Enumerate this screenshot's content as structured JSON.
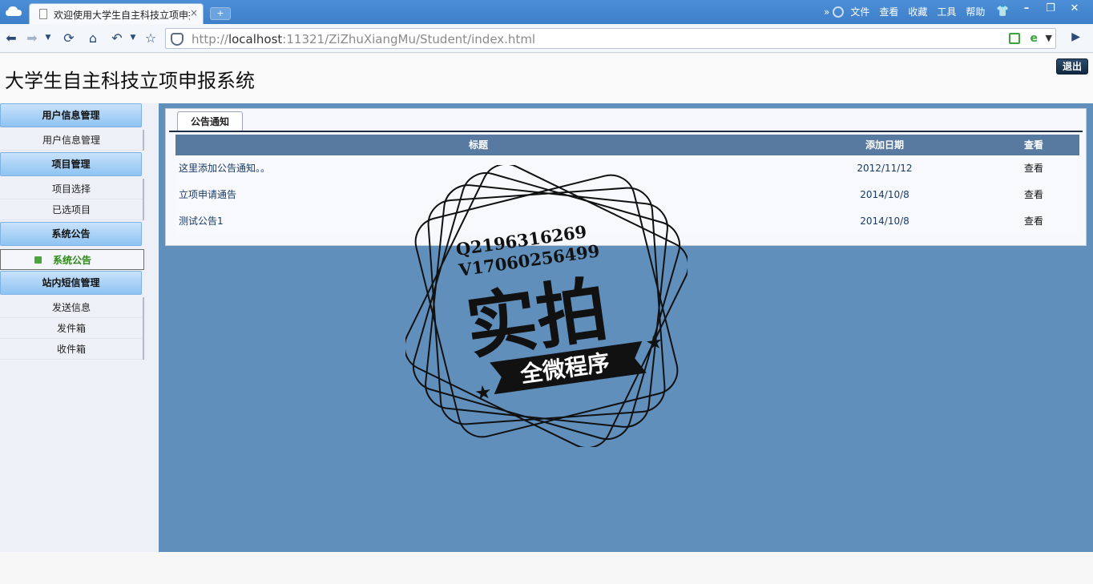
{
  "browser": {
    "tab_title": "欢迎使用大学生自主科技立项申报",
    "tab_close": "×",
    "new_tab": "+",
    "menu": [
      "文件",
      "查看",
      "收藏",
      "工具",
      "帮助"
    ],
    "menu_more": "»",
    "url_prefix": "http://",
    "url_host": "localhost",
    "url_rest": ":11321/ZiZhuXiangMu/Student/index.html"
  },
  "header": {
    "title": "大学生自主科技立项申报系统",
    "logout_label": "退出"
  },
  "sidebar": {
    "groups": [
      {
        "title": "用户信息管理",
        "items": [
          "用户信息管理"
        ]
      },
      {
        "title": "项目管理",
        "items": [
          "项目选择",
          "已选项目"
        ]
      },
      {
        "title": "系统公告",
        "items": [
          "系统公告"
        ]
      },
      {
        "title": "站内短信管理",
        "items": [
          "发送信息",
          "发件箱",
          "收件箱"
        ]
      }
    ],
    "active_item": "系统公告"
  },
  "main": {
    "tab_label": "公告通知",
    "table": {
      "headers": [
        "标题",
        "添加日期",
        "查看"
      ],
      "rows": [
        {
          "title": "这里添加公告通知。。",
          "date": "2012/11/12",
          "action": "查看"
        },
        {
          "title": "立项申请通告",
          "date": "2014/10/8",
          "action": "查看"
        },
        {
          "title": "测试公告1",
          "date": "2014/10/8",
          "action": "查看"
        }
      ]
    }
  },
  "watermark": {
    "line1": "Q2196316269",
    "line2": "V17060256499",
    "big": "实拍",
    "banner": "全微程序"
  },
  "colors": {
    "titlebar": "#4c8fd6",
    "main_bg": "#608fbc",
    "table_header": "#597aa0",
    "active_item": "#2d8a16"
  }
}
